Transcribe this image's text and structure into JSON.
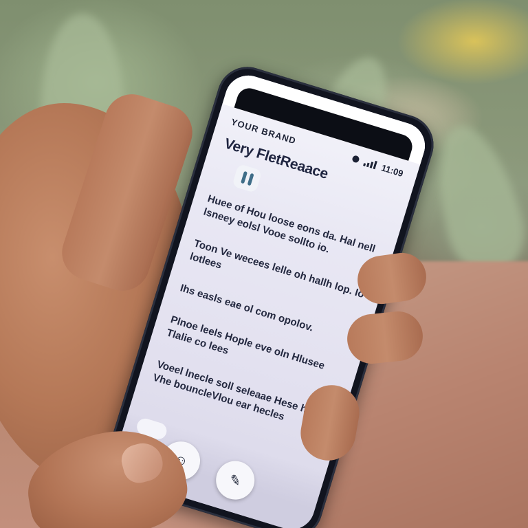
{
  "phone": {
    "status": {
      "left_text": "YOUR BRAND",
      "time": "11:09"
    },
    "app_title": "Very FletReaace",
    "paragraphs": [
      "Huee of Hou loose eons da. Hal nell lsneey eolsl Vooe sollto io.",
      "Toon Ve wecees lelle oh hallh lop. Io lotlees",
      "Ihs easls eae ol com opolov.",
      "Plnoe leels Hople eve oln Hlusee Tlalie co lees",
      "Voeel lnecle soll seleaae Hese hon Vhe bouncleVlou ear hecles"
    ],
    "bottom_icons": [
      "sticker-icon",
      "chat-icon"
    ]
  },
  "colors": {
    "phone_frame": "#11141f",
    "screen_bg": "#ecebf5",
    "text": "#23283f",
    "foliage": "#8d9a7c",
    "ground": "#b98470",
    "skin": "#b57857"
  }
}
